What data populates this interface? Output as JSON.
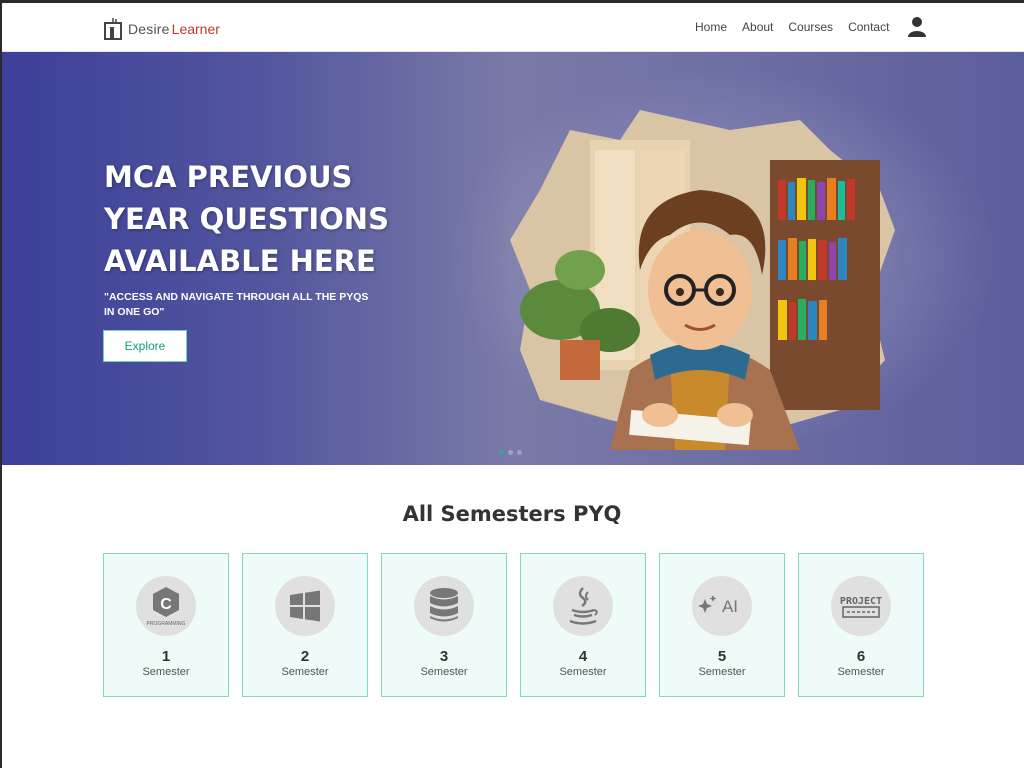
{
  "navbar": {
    "logo_part1": "Desire",
    "logo_part2": "Learner",
    "links": [
      "Home",
      "About",
      "Courses",
      "Contact"
    ]
  },
  "hero": {
    "title": "MCA PREVIOUS YEAR QUESTIONS AVAILABLE HERE",
    "subtitle": "\"ACCESS AND NAVIGATE THROUGH ALL THE PYQS IN ONE GO\"",
    "button_label": "Explore",
    "carousel_active_index": 0,
    "carousel_count": 3
  },
  "section": {
    "title": "All Semesters PYQ"
  },
  "semesters": [
    {
      "number": "1",
      "label": "Semester",
      "icon": "c-programming-icon",
      "icon_text": "PROGRAMMING"
    },
    {
      "number": "2",
      "label": "Semester",
      "icon": "windows-icon"
    },
    {
      "number": "3",
      "label": "Semester",
      "icon": "database-icon"
    },
    {
      "number": "4",
      "label": "Semester",
      "icon": "java-icon"
    },
    {
      "number": "5",
      "label": "Semester",
      "icon": "ai-sparkle-icon",
      "icon_text": "AI"
    },
    {
      "number": "6",
      "label": "Semester",
      "icon": "project-icon",
      "icon_text": "PROJECT"
    }
  ],
  "colors": {
    "accent": "#159a80",
    "card_border": "#7fd9c6",
    "card_bg": "#eefbf8",
    "hero_start": "#3d3f99",
    "hero_end": "#5c5e9c"
  }
}
